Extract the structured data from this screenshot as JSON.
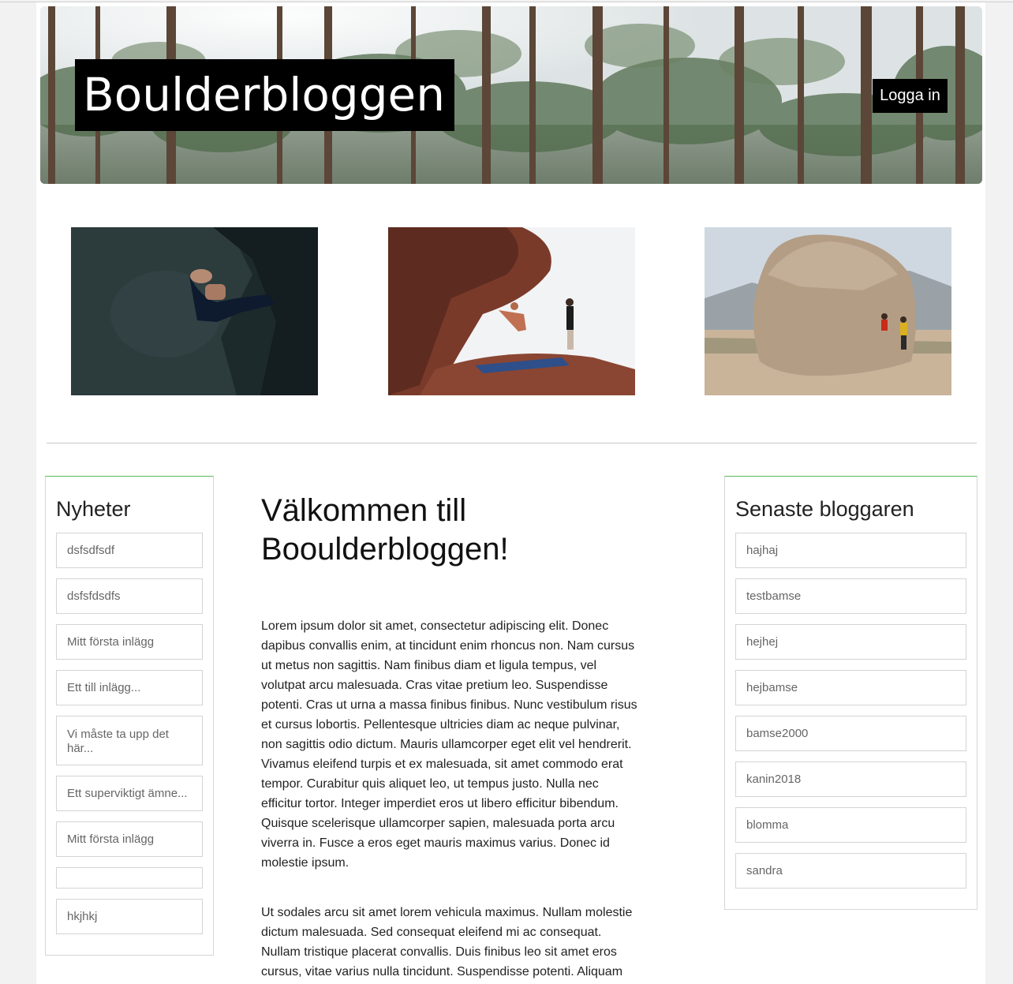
{
  "header": {
    "site_title": "Boulderbloggen",
    "login_label": "Logga in"
  },
  "gallery": [
    {
      "name": "climber-dark-rock"
    },
    {
      "name": "climber-overhang"
    },
    {
      "name": "boulder-mountain"
    }
  ],
  "news": {
    "heading": "Nyheter",
    "items": [
      "dsfsdfsdf",
      "dsfsfdsdfs",
      "Mitt första inlägg",
      "Ett till inlägg...",
      "Vi måste ta upp det här...",
      "Ett superviktigt ämne...",
      "Mitt första inlägg",
      "",
      "hkjhkj"
    ]
  },
  "bloggers": {
    "heading": "Senaste bloggaren",
    "items": [
      "hajhaj",
      "testbamse",
      "hejhej",
      "hejbamse",
      "bamse2000",
      "kanin2018",
      "blomma",
      "sandra"
    ]
  },
  "article": {
    "title": "Välkommen till Booulderbloggen!",
    "paragraphs": [
      "Lorem ipsum dolor sit amet, consectetur adipiscing elit. Donec dapibus convallis enim, at tincidunt enim rhoncus non. Nam cursus ut metus non sagittis. Nam finibus diam et ligula tempus, vel volutpat arcu malesuada. Cras vitae pretium leo. Suspendisse potenti. Cras ut urna a massa finibus finibus. Nunc vestibulum risus et cursus lobortis. Pellentesque ultricies diam ac neque pulvinar, non sagittis odio dictum. Mauris ullamcorper eget elit vel hendrerit. Vivamus eleifend turpis et ex malesuada, sit amet commodo erat tempor. Curabitur quis aliquet leo, ut tempus justo. Nulla nec efficitur tortor. Integer imperdiet eros ut libero efficitur bibendum. Quisque scelerisque ullamcorper sapien, malesuada porta arcu viverra in. Fusce a eros eget mauris maximus varius. Donec id molestie ipsum.",
      "Ut sodales arcu sit amet lorem vehicula maximus. Nullam molestie dictum malesuada. Sed consequat eleifend mi ac consequat. Nullam tristique placerat convallis. Duis finibus leo sit amet eros cursus, vitae varius nulla tincidunt. Suspendisse potenti. Aliquam"
    ]
  },
  "colors": {
    "panel_accent": "#5cb85c",
    "brand_bg": "#000000",
    "brand_text": "#ffffff"
  }
}
